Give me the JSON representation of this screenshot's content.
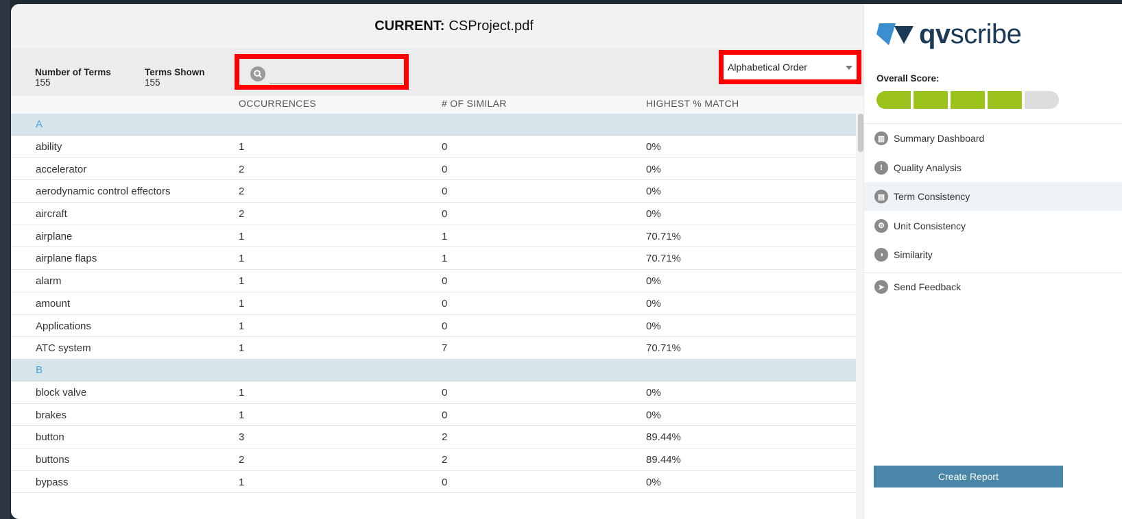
{
  "title": {
    "prefix": "CURRENT:",
    "filename": "CSProject.pdf"
  },
  "stats": {
    "number_of_terms_label": "Number of Terms",
    "number_of_terms_value": "155",
    "terms_shown_label": "Terms Shown",
    "terms_shown_value": "155"
  },
  "search": {
    "placeholder": "",
    "value": ""
  },
  "sort": {
    "selected": "Alphabetical Order"
  },
  "columns": {
    "occurrences": "OCCURRENCES",
    "similar": "# OF SIMILAR",
    "match": "HIGHEST % MATCH"
  },
  "groups": [
    {
      "letter": "A",
      "rows": [
        {
          "term": "ability",
          "occurrences": "1",
          "similar": "0",
          "match": "0%"
        },
        {
          "term": "accelerator",
          "occurrences": "2",
          "similar": "0",
          "match": "0%"
        },
        {
          "term": "aerodynamic control effectors",
          "occurrences": "2",
          "similar": "0",
          "match": "0%"
        },
        {
          "term": "aircraft",
          "occurrences": "2",
          "similar": "0",
          "match": "0%"
        },
        {
          "term": "airplane",
          "occurrences": "1",
          "similar": "1",
          "match": "70.71%"
        },
        {
          "term": "airplane flaps",
          "occurrences": "1",
          "similar": "1",
          "match": "70.71%"
        },
        {
          "term": "alarm",
          "occurrences": "1",
          "similar": "0",
          "match": "0%"
        },
        {
          "term": "amount",
          "occurrences": "1",
          "similar": "0",
          "match": "0%"
        },
        {
          "term": "Applications",
          "occurrences": "1",
          "similar": "0",
          "match": "0%"
        },
        {
          "term": "ATC system",
          "occurrences": "1",
          "similar": "7",
          "match": "70.71%"
        }
      ]
    },
    {
      "letter": "B",
      "rows": [
        {
          "term": "block valve",
          "occurrences": "1",
          "similar": "0",
          "match": "0%"
        },
        {
          "term": "brakes",
          "occurrences": "1",
          "similar": "0",
          "match": "0%"
        },
        {
          "term": "button",
          "occurrences": "3",
          "similar": "2",
          "match": "89.44%"
        },
        {
          "term": "buttons",
          "occurrences": "2",
          "similar": "2",
          "match": "89.44%"
        },
        {
          "term": "bypass",
          "occurrences": "1",
          "similar": "0",
          "match": "0%"
        }
      ]
    }
  ],
  "sidebar": {
    "logo_bold": "qv",
    "logo_rest": "scribe",
    "overall_score_label": "Overall Score:",
    "score_segments_filled": 4,
    "score_segments_total": 5,
    "nav": [
      {
        "label": "Summary Dashboard",
        "icon": "dashboard-icon"
      },
      {
        "label": "Quality Analysis",
        "icon": "warning-icon"
      },
      {
        "label": "Term Consistency",
        "icon": "document-icon",
        "active": true
      },
      {
        "label": "Unit Consistency",
        "icon": "units-icon"
      },
      {
        "label": "Similarity",
        "icon": "similarity-icon"
      }
    ],
    "feedback_label": "Send Feedback",
    "create_report_label": "Create Report"
  },
  "colors": {
    "accent": "#4a86a8",
    "score_fill": "#9bc31c",
    "highlight": "#ff0000",
    "group_letter": "#4aa3d8"
  }
}
